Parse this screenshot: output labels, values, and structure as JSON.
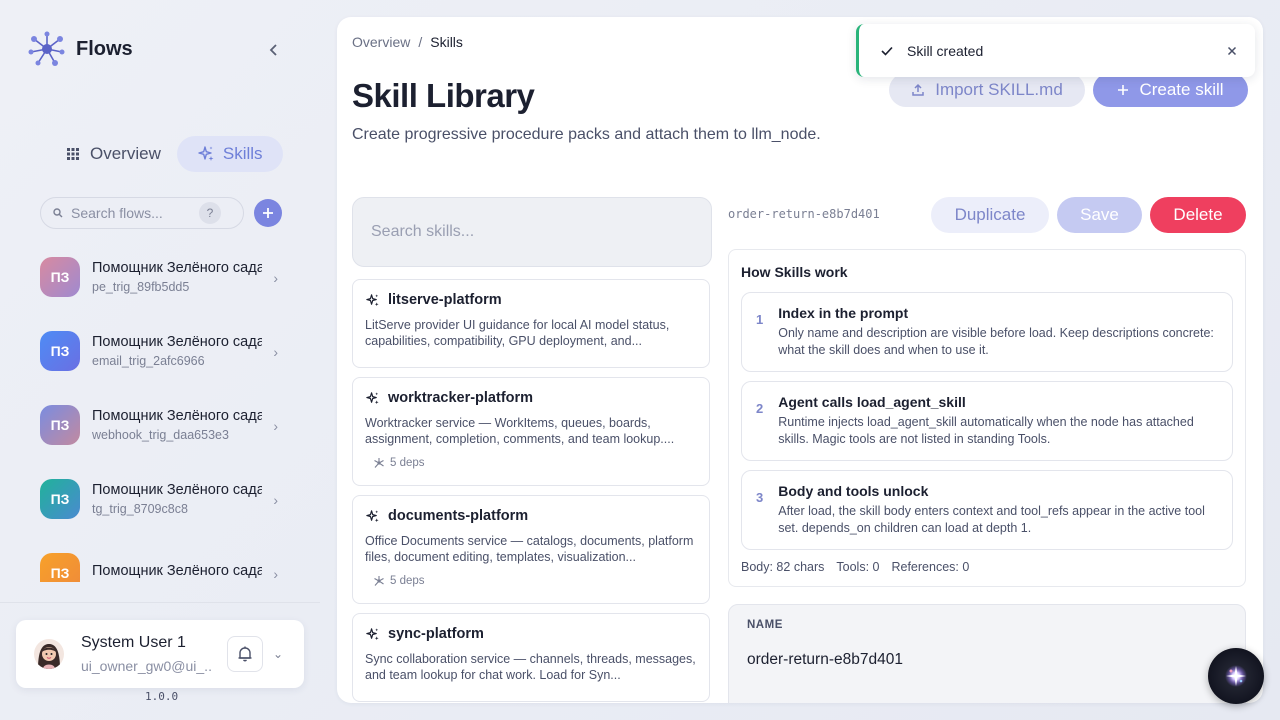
{
  "app": {
    "name": "Flows"
  },
  "nav": {
    "modes": [
      {
        "label": "Overview",
        "icon": "grid-icon",
        "active": false
      },
      {
        "label": "Skills",
        "icon": "sparkle-icon",
        "active": true
      }
    ]
  },
  "flow_search": {
    "placeholder": "Search flows...",
    "help": "?"
  },
  "flows": [
    {
      "initials": "ПЗ",
      "name": "Помощник Зелёного сада",
      "sub": "pe_trig_89fb5dd5",
      "color": "#c38aa6"
    },
    {
      "initials": "ПЗ",
      "name": "Помощник Зелёного сада",
      "sub": "email_trig_2afc6966",
      "color": "#5a7ef0"
    },
    {
      "initials": "ПЗ",
      "name": "Помощник Зелёного сада",
      "sub": "webhook_trig_daa653e3",
      "color": "#9a7fc0"
    },
    {
      "initials": "ПЗ",
      "name": "Помощник Зелёного сада",
      "sub": "tg_trig_8709c8c8",
      "color": "#2fb0a0"
    },
    {
      "initials": "ПЗ",
      "name": "Помощник Зелёного сада",
      "sub": "",
      "color": "#f5a02d"
    }
  ],
  "user": {
    "name": "System User 1",
    "email": "ui_owner_gw0@ui_..."
  },
  "version": "1.0.0",
  "breadcrumb": {
    "root": "Overview",
    "separator": "/",
    "current": "Skills"
  },
  "page": {
    "title": "Skill Library",
    "description": "Create progressive procedure packs and attach them to llm_node.",
    "import_label": "Import SKILL.md",
    "create_label": "Create skill"
  },
  "skill_search": {
    "placeholder": "Search skills..."
  },
  "skills": [
    {
      "name": "litserve-platform",
      "description": "LitServe provider UI guidance for local AI model status, capabilities, compatibility, GPU deployment, and...",
      "deps": ""
    },
    {
      "name": "worktracker-platform",
      "description": "Worktracker service — WorkItems, queues, boards, assignment, completion, comments, and team lookup....",
      "deps": "5 deps"
    },
    {
      "name": "documents-platform",
      "description": "Office Documents service — catalogs, documents, platform files, document editing, templates, visualization...",
      "deps": "5 deps"
    },
    {
      "name": "sync-platform",
      "description": "Sync collaboration service — channels, threads, messages, and team lookup for chat work. Load for Syn...",
      "deps": ""
    }
  ],
  "detail": {
    "id": "order-return-e8b7d401",
    "duplicate_label": "Duplicate",
    "save_label": "Save",
    "delete_label": "Delete",
    "how": {
      "title": "How Skills work",
      "steps": [
        {
          "num": "1",
          "title": "Index in the prompt",
          "text": "Only name and description are visible before load. Keep descriptions concrete: what the skill does and when to use it."
        },
        {
          "num": "2",
          "title": "Agent calls load_agent_skill",
          "text": "Runtime injects load_agent_skill automatically when the node has attached skills. Magic tools are not listed in standing Tools."
        },
        {
          "num": "3",
          "title": "Body and tools unlock",
          "text": "After load, the skill body enters context and tool_refs appear in the active tool set. depends_on children can load at depth 1."
        }
      ],
      "stats": {
        "body": "Body: 82 chars",
        "tools": "Tools: 0",
        "references": "References: 0"
      }
    },
    "name_field": {
      "label": "NAME",
      "value": "order-return-e8b7d401"
    }
  },
  "toast": {
    "text": "Skill created",
    "status_color": "#29b47a"
  },
  "colors": {
    "accent": "#7b85e0",
    "danger": "#ef3f5f"
  }
}
